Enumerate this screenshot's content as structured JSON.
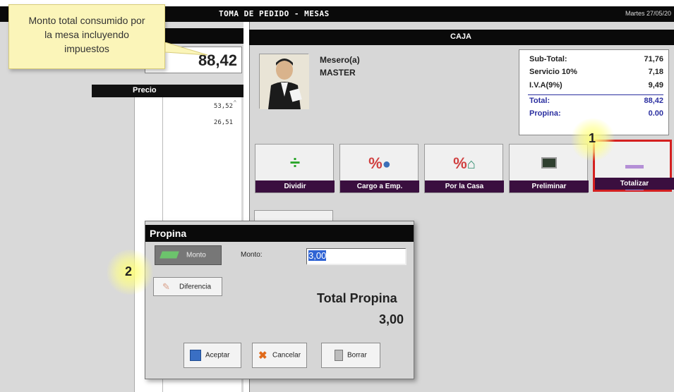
{
  "window": {
    "title": "TOMA DE PEDIDO - MESAS",
    "date": "Martes 27/05/20"
  },
  "callout": {
    "text_line1": "Monto total consumido  por",
    "text_line2": "la mesa incluyendo",
    "text_line3": "impuestos"
  },
  "left_panel": {
    "total": "88,42",
    "price_header": "Precio",
    "prices": [
      "53,52",
      "26,51"
    ]
  },
  "caja": {
    "header": "CAJA",
    "waiter_label": "Mesero(a)",
    "waiter_name": "MASTER",
    "summary": [
      {
        "label": "Sub-Total:",
        "value": "71,76"
      },
      {
        "label": "Servicio 10%",
        "value": "7,18"
      },
      {
        "label": "I.V.A(9%)",
        "value": "9,49"
      },
      {
        "label": "Total:",
        "value": "88,42"
      },
      {
        "label": "Propina:",
        "value": "0.00"
      }
    ]
  },
  "toolbar": {
    "buttons": [
      {
        "label": "Dividir",
        "icon": "divide-icon"
      },
      {
        "label": "Cargo a Emp.",
        "icon": "percent-person-icon"
      },
      {
        "label": "Por la Casa",
        "icon": "percent-house-icon"
      },
      {
        "label": "Preliminar",
        "icon": "preview-icon"
      },
      {
        "label": "Totalizar",
        "icon": "totalize-icon"
      }
    ]
  },
  "markers": {
    "step1": "1",
    "step2": "2"
  },
  "propina_dialog": {
    "title": "Propina",
    "monto_button": "Monto",
    "diferencia_button": "Diferencia",
    "monto_label": "Monto:",
    "monto_value": "3,00",
    "total_label": "Total Propina",
    "total_value": "3,00",
    "accept": "Aceptar",
    "cancel": "Cancelar",
    "delete": "Borrar"
  },
  "colors": {
    "button_label_bg": "#3a0f3f",
    "highlight_border": "#d42020",
    "summary_blue": "#2b2fa0",
    "callout_bg": "#fbf5b9"
  }
}
